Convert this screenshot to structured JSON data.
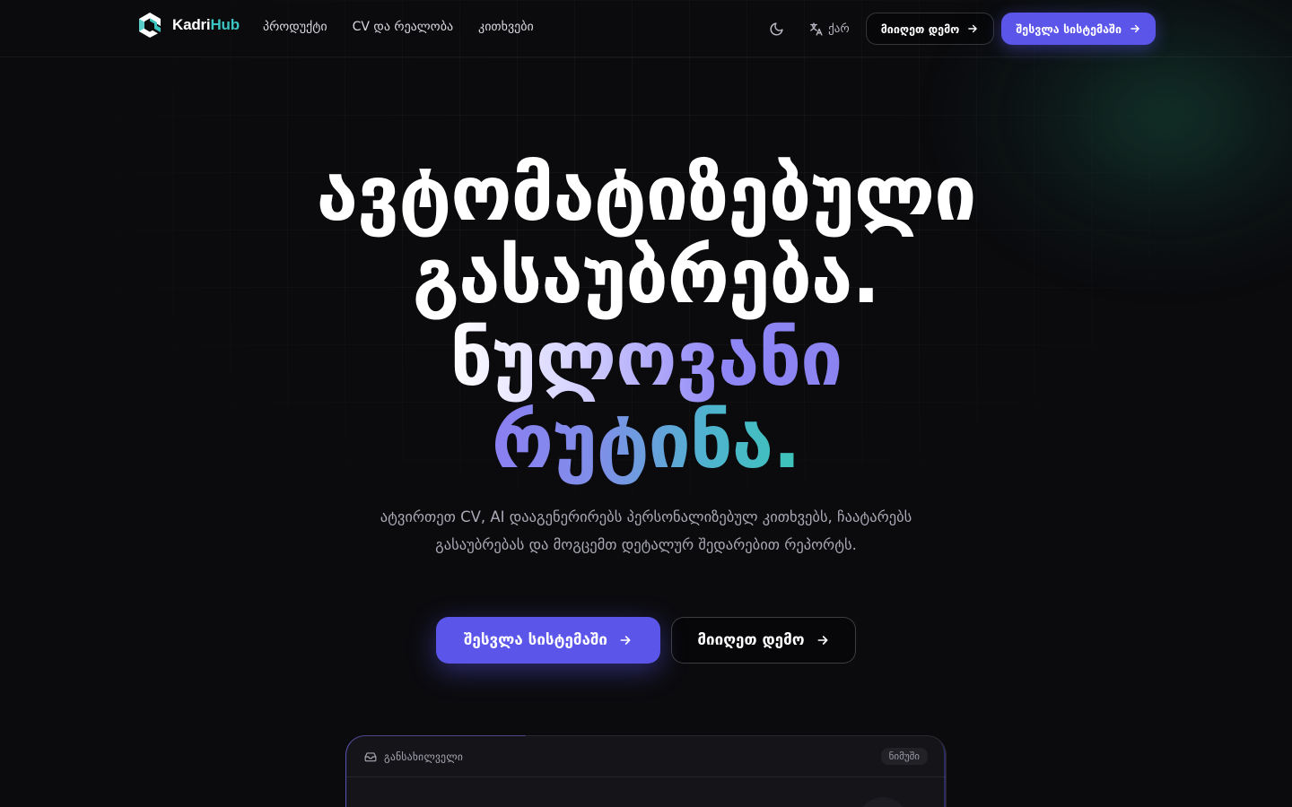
{
  "brand": {
    "name_part1": "Kadri",
    "name_part2": "Hub",
    "accent": "#3cc4c0",
    "primary": "#5b55ea"
  },
  "nav": {
    "links": [
      "პროდუქტი",
      "CV და რეალობა",
      "კითხვები"
    ],
    "theme_icon": "moon-icon",
    "language": {
      "icon": "translate-icon",
      "label": "ქარ"
    },
    "demo_button": "მიიღეთ დემო",
    "login_button": "შესვლა სისტემაში"
  },
  "hero": {
    "line1": "ავტომატიზებული",
    "line2": "გასაუბრება.",
    "line3": "ნულოვანი",
    "line4": "რუტინა.",
    "subtitle": "ატვირთეთ CV, AI დააგენერირებს პერსონალიზებულ კითხვებს, ჩაატარებს გასაუბრებას და მოგცემთ დეტალურ შედარებით რეპორტს.",
    "primary_cta": "შესვლა სისტემაში",
    "secondary_cta": "მიიღეთ დემო"
  },
  "preview": {
    "title": "განსახილველი",
    "badge": "ნიმუში",
    "icon": "inbox-icon"
  }
}
